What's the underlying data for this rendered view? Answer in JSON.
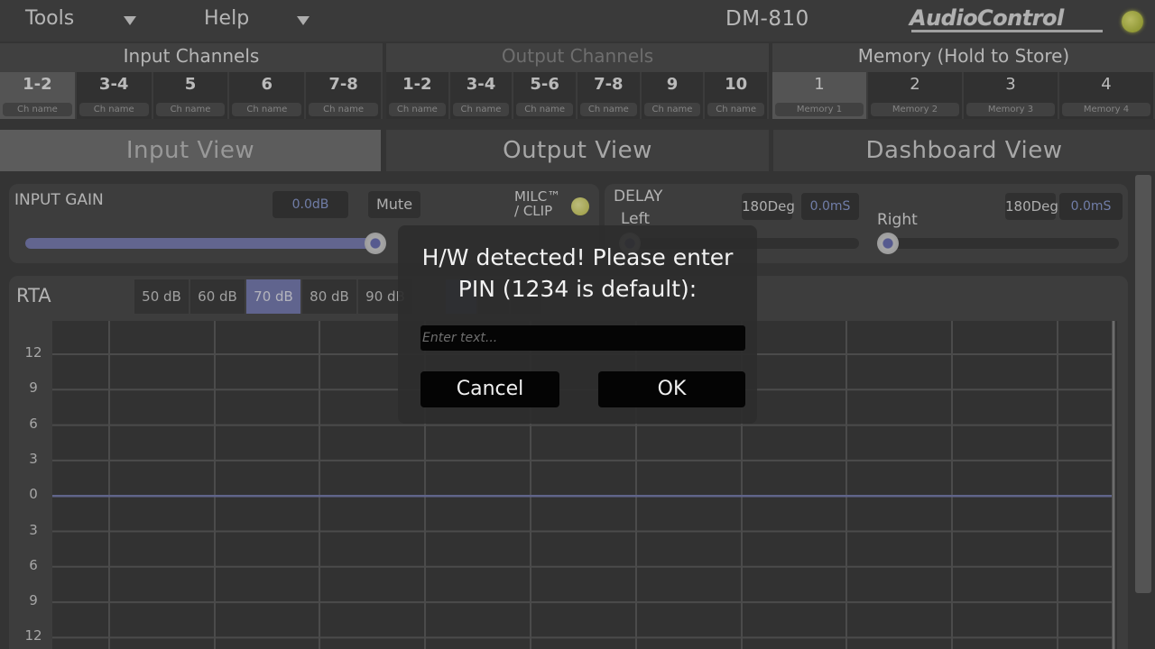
{
  "menu": {
    "tools": "Tools",
    "help": "Help"
  },
  "device_name": "DM-810",
  "brand": "AudioControl",
  "input_channels": {
    "title": "Input Channels",
    "channels": [
      {
        "label": "1-2",
        "caption": "Ch name",
        "selected": true
      },
      {
        "label": "3-4",
        "caption": "Ch name"
      },
      {
        "label": "5",
        "caption": "Ch name"
      },
      {
        "label": "6",
        "caption": "Ch name"
      },
      {
        "label": "7-8",
        "caption": "Ch name"
      }
    ]
  },
  "output_channels": {
    "title": "Output Channels",
    "channels": [
      {
        "label": "1-2",
        "caption": "Ch name"
      },
      {
        "label": "3-4",
        "caption": "Ch name"
      },
      {
        "label": "5-6",
        "caption": "Ch name"
      },
      {
        "label": "7-8",
        "caption": "Ch name"
      },
      {
        "label": "9",
        "caption": "Ch name"
      },
      {
        "label": "10",
        "caption": "Ch name"
      }
    ]
  },
  "memory": {
    "title": "Memory (Hold to Store)",
    "slots": [
      {
        "label": "1",
        "caption": "Memory 1",
        "selected": true
      },
      {
        "label": "2",
        "caption": "Memory 2"
      },
      {
        "label": "3",
        "caption": "Memory 3"
      },
      {
        "label": "4",
        "caption": "Memory 4"
      }
    ]
  },
  "views": {
    "input": "Input View",
    "output": "Output View",
    "dashboard": "Dashboard View"
  },
  "input_gain": {
    "label": "INPUT GAIN",
    "value": "0.0dB",
    "mute": "Mute",
    "milc_line1": "MILC™",
    "milc_line2": "/ CLIP",
    "level": 1.0
  },
  "delay": {
    "label": "DELAY",
    "left": {
      "label": "Left",
      "phase": "180Deg",
      "value": "0.0mS"
    },
    "right": {
      "label": "Right",
      "phase": "180Deg",
      "value": "0.0mS"
    }
  },
  "rta": {
    "label": "RTA",
    "levels": [
      "50 dB",
      "60 dB",
      "70 dB",
      "80 dB",
      "90 dB"
    ],
    "selected_level": "70 dB",
    "y_ticks": [
      "12",
      "9",
      "6",
      "3",
      "0",
      "3",
      "6",
      "9",
      "12"
    ]
  },
  "dialog": {
    "message_line1": "H/W detected! Please enter",
    "message_line2": "PIN (1234 is default):",
    "input_placeholder": "Enter text...",
    "cancel": "Cancel",
    "ok": "OK"
  },
  "colors": {
    "accent": "#7c80b8",
    "led": "#d6d96a",
    "background": "#3f3f3f"
  }
}
